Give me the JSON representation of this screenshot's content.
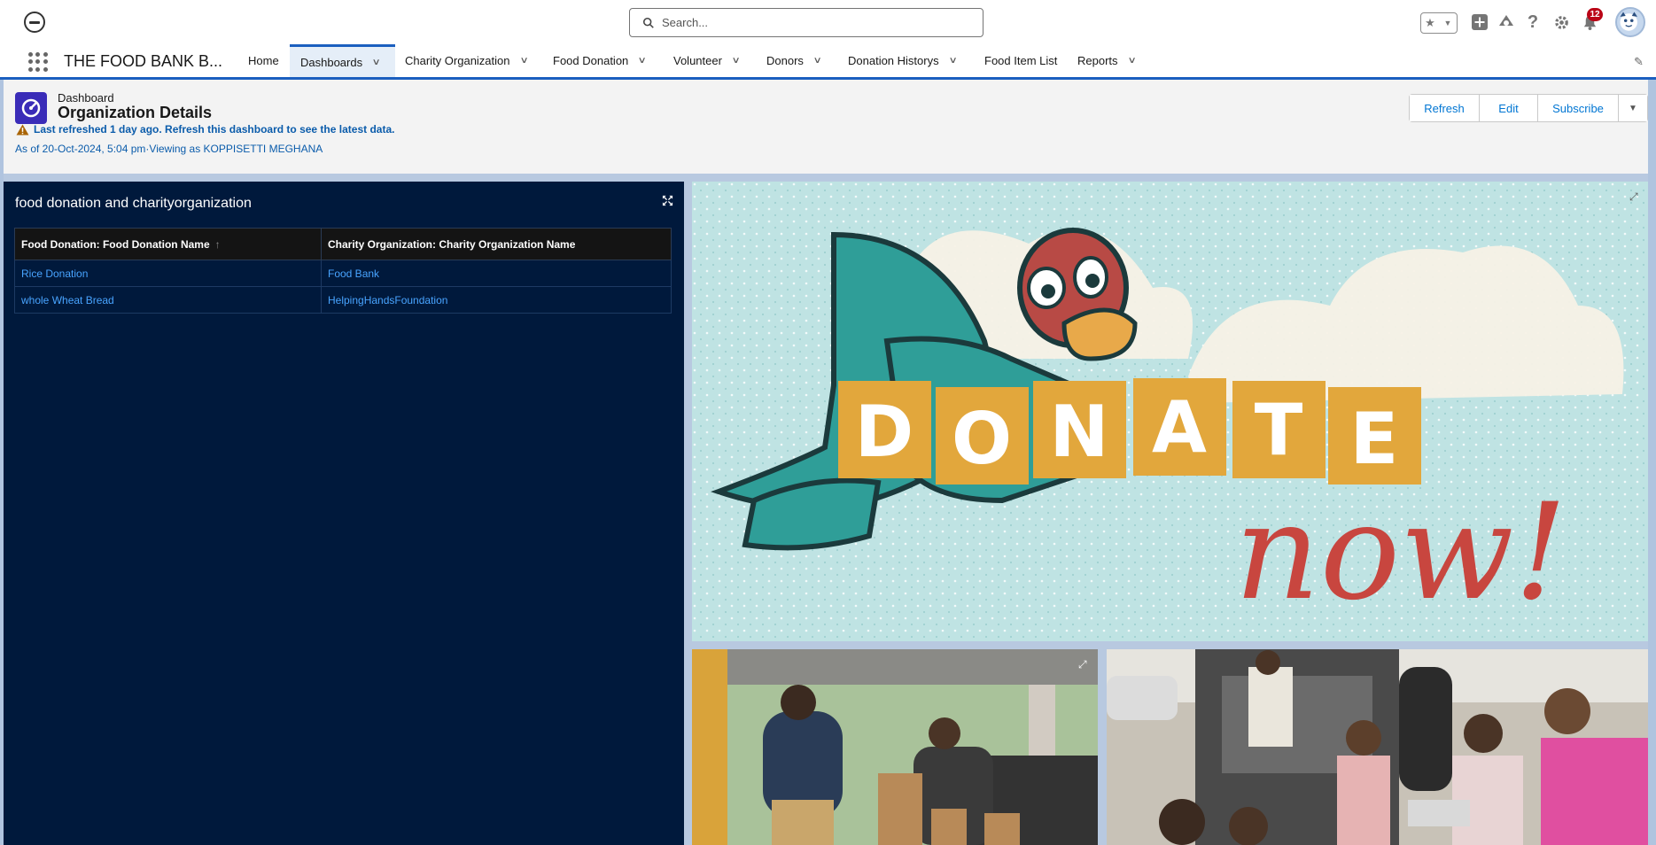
{
  "header": {
    "search_placeholder": "Search...",
    "notification_count": "12"
  },
  "nav": {
    "app_name": "THE FOOD BANK B...",
    "items": [
      {
        "label": "Home",
        "has_menu": false
      },
      {
        "label": "Dashboards",
        "has_menu": true,
        "active": true
      },
      {
        "label": "Charity Organization",
        "has_menu": true
      },
      {
        "label": "Food Donation",
        "has_menu": true
      },
      {
        "label": "Volunteer",
        "has_menu": true
      },
      {
        "label": "Donors",
        "has_menu": true
      },
      {
        "label": "Donation Historys",
        "has_menu": true
      },
      {
        "label": "Food Item List",
        "has_menu": false
      },
      {
        "label": "Reports",
        "has_menu": true
      }
    ]
  },
  "dashboard": {
    "type_label": "Dashboard",
    "title": "Organization Details",
    "warning": "Last refreshed 1 day ago. Refresh this dashboard to see the latest data.",
    "as_of": "As of 20-Oct-2024, 5:04 pm·Viewing as KOPPISETTI MEGHANA",
    "buttons": {
      "refresh": "Refresh",
      "edit": "Edit",
      "subscribe": "Subscribe"
    }
  },
  "table_widget": {
    "title": "food donation and charityorganization",
    "columns": [
      "Food Donation: Food Donation Name",
      "Charity Organization: Charity Organization Name"
    ],
    "sort_indicator": "↑",
    "rows": [
      [
        "Rice Donation",
        "Food Bank"
      ],
      [
        "whole Wheat Bread",
        "HelpingHandsFoundation"
      ]
    ]
  },
  "images": {
    "donate_letters": [
      "D",
      "O",
      "N",
      "A",
      "T",
      "E"
    ],
    "donate_script": "now!"
  },
  "colors": {
    "brand_blue": "#1b5fbf",
    "link_blue": "#0176d3",
    "table_bg": "#00193c",
    "dashboard_icon": "#3a2cb8",
    "badge_red": "#ba0517",
    "donate_orange": "#e2a73c",
    "donate_red": "#c8463f"
  }
}
